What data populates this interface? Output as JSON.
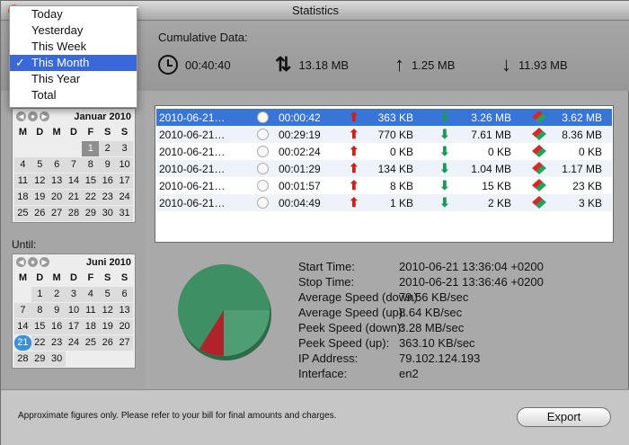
{
  "window": {
    "title": "Statistics"
  },
  "cumulative": {
    "label": "Cumulative Data:",
    "duration": "00:40:40",
    "total": "13.18 MB",
    "upload": "1.25 MB",
    "download": "11.93 MB"
  },
  "period_menu": {
    "items": [
      {
        "label": "Today"
      },
      {
        "label": "Yesterday"
      },
      {
        "label": "This Week"
      },
      {
        "label": "This Month",
        "check": "✓"
      },
      {
        "label": "This Year"
      },
      {
        "label": "Total"
      }
    ]
  },
  "calendar_from": {
    "month": "Januar 2010",
    "dow": [
      "M",
      "D",
      "M",
      "D",
      "F",
      "S",
      "S"
    ],
    "days": [
      "",
      "",
      "",
      "",
      "1",
      "2",
      "3",
      "4",
      "5",
      "6",
      "7",
      "8",
      "9",
      "10",
      "11",
      "12",
      "13",
      "14",
      "15",
      "16",
      "17",
      "18",
      "19",
      "20",
      "21",
      "22",
      "23",
      "24",
      "25",
      "26",
      "27",
      "28",
      "29",
      "30",
      "31"
    ]
  },
  "until": {
    "label": "Until:"
  },
  "calendar_until": {
    "month": "Juni 2010",
    "dow": [
      "M",
      "D",
      "M",
      "D",
      "F",
      "S",
      "S"
    ],
    "days": [
      "",
      "1",
      "2",
      "3",
      "4",
      "5",
      "6",
      "7",
      "8",
      "9",
      "10",
      "11",
      "12",
      "13",
      "14",
      "15",
      "16",
      "17",
      "18",
      "19",
      "20",
      "21",
      "22",
      "23",
      "24",
      "25",
      "26",
      "27",
      "28",
      "29",
      "30"
    ]
  },
  "sessions": [
    {
      "date": "2010-06-21…",
      "duration": "00:00:42",
      "up": "363 KB",
      "down": "3.26 MB",
      "total": "3.62 MB"
    },
    {
      "date": "2010-06-21…",
      "duration": "00:29:19",
      "up": "770 KB",
      "down": "7.61 MB",
      "total": "8.36 MB"
    },
    {
      "date": "2010-06-21…",
      "duration": "00:02:24",
      "up": "0 KB",
      "down": "0 KB",
      "total": "0 KB"
    },
    {
      "date": "2010-06-21…",
      "duration": "00:01:29",
      "up": "134 KB",
      "down": "1.04 MB",
      "total": "1.17 MB"
    },
    {
      "date": "2010-06-21…",
      "duration": "00:01:57",
      "up": "8 KB",
      "down": "15 KB",
      "total": "23 KB"
    },
    {
      "date": "2010-06-21…",
      "duration": "00:04:49",
      "up": "1 KB",
      "down": "2 KB",
      "total": "3 KB"
    }
  ],
  "details": [
    {
      "label": "Start Time:",
      "value": "2010-06-21 13:36:04 +0200"
    },
    {
      "label": "Stop Time:",
      "value": "2010-06-21 13:36:46 +0200"
    },
    {
      "label": "Average Speed (down):",
      "value": "79.56 KB/sec"
    },
    {
      "label": "Average Speed (up):",
      "value": "8.64 KB/sec"
    },
    {
      "label": "Peek Speed (down):",
      "value": "3.28 MB/sec"
    },
    {
      "label": "Peek Speed (up):",
      "value": "363.10 KB/sec"
    },
    {
      "label": "IP Address:",
      "value": "79.102.124.193"
    },
    {
      "label": "Interface:",
      "value": "en2"
    }
  ],
  "footer": {
    "note": "Approximate figures only. Please refer to your bill for final amounts and charges.",
    "export_label": "Export"
  },
  "colors": {
    "selection": "#3875d7",
    "up_arrow": "#cf2020",
    "down_arrow": "#1a9a57",
    "pie_green": "#3e8f63",
    "pie_red": "#b1232a"
  }
}
